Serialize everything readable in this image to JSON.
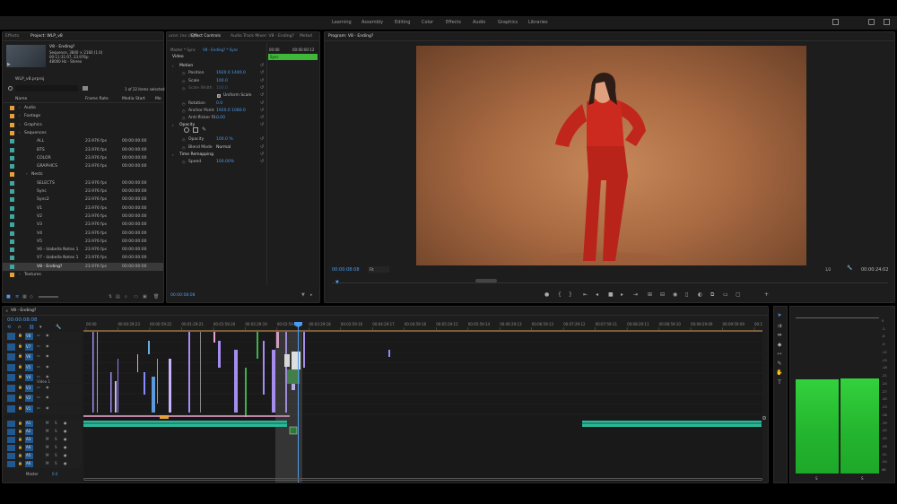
{
  "workspaces": [
    "Learning",
    "Assembly",
    "Editing",
    "Color",
    "Effects",
    "Audio",
    "Graphics",
    "Libraries"
  ],
  "project": {
    "tabs": [
      "Effects",
      "Project: WLP_v8"
    ],
    "clip_name": "V8 - Ending?",
    "clip_info": [
      "Sequence, 3840 × 2160 (1.0)",
      "00:11:31:07, 23.976p",
      "48000 Hz - Stereo"
    ],
    "file_name": "WLP_v8.prproj",
    "items_selected": "1 of 22 items selected",
    "columns": [
      "Name",
      "Frame Rate",
      "Media Start",
      "Me"
    ],
    "rows": [
      {
        "name": "Audio",
        "rate": "",
        "start": "",
        "color": "#e8a13a"
      },
      {
        "name": "Footage",
        "rate": "",
        "start": "",
        "color": "#e8a13a"
      },
      {
        "name": "Graphics",
        "rate": "",
        "start": "",
        "color": "#e8a13a"
      },
      {
        "name": "Sequences",
        "rate": "",
        "start": "",
        "color": "#e8a13a"
      },
      {
        "name": "ALL",
        "rate": "23.976 fps",
        "start": "00:00:00:00",
        "color": "#3fa6a0"
      },
      {
        "name": "BTS",
        "rate": "23.976 fps",
        "start": "00:00:00:00",
        "color": "#3fa6a0"
      },
      {
        "name": "COLOR",
        "rate": "23.976 fps",
        "start": "00:00:00:00",
        "color": "#3fa6a0"
      },
      {
        "name": "GRAPHICS",
        "rate": "23.976 fps",
        "start": "00:00:00:00",
        "color": "#3fa6a0"
      },
      {
        "name": "Nests",
        "rate": "",
        "start": "",
        "color": "#e8a13a"
      },
      {
        "name": "SELECTS",
        "rate": "23.976 fps",
        "start": "00:00:00:00",
        "color": "#3fa6a0"
      },
      {
        "name": "Sync",
        "rate": "23.976 fps",
        "start": "00:00:00:00",
        "color": "#3fa6a0"
      },
      {
        "name": "Sync2",
        "rate": "23.976 fps",
        "start": "00:00:00:00",
        "color": "#3fa6a0"
      },
      {
        "name": "V1",
        "rate": "23.976 fps",
        "start": "00:00:00:00",
        "color": "#3fa6a0"
      },
      {
        "name": "V2",
        "rate": "23.976 fps",
        "start": "00:00:00:00",
        "color": "#3fa6a0"
      },
      {
        "name": "V3",
        "rate": "23.976 fps",
        "start": "00:00:00:00",
        "color": "#3fa6a0"
      },
      {
        "name": "V4",
        "rate": "23.976 fps",
        "start": "00:00:00:00",
        "color": "#3fa6a0"
      },
      {
        "name": "V5",
        "rate": "23.976 fps",
        "start": "00:00:00:00",
        "color": "#3fa6a0"
      },
      {
        "name": "V6 - Izabella Notes 1",
        "rate": "23.976 fps",
        "start": "00:00:00:00",
        "color": "#3fa6a0"
      },
      {
        "name": "V7 - Izabella Notes 1",
        "rate": "23.976 fps",
        "start": "00:00:00:00",
        "color": "#3fa6a0"
      },
      {
        "name": "V8 - Ending?",
        "rate": "23.976 fps",
        "start": "00:00:00:00",
        "color": "#3fa6a0"
      },
      {
        "name": "Textures",
        "rate": "",
        "start": "",
        "color": "#e8a13a"
      }
    ]
  },
  "effect_controls": {
    "tabs": [
      "urce: (no clips)",
      "Effect Controls",
      "Audio Track Mixer: V8 - Ending?",
      "Metad"
    ],
    "master_label": "Master * Sync",
    "seq_label": "V8 - Ending? * Sync",
    "time_start": "00:00",
    "time_end": "00:00:00:12",
    "clip_bar": "Sync",
    "section_video": "Video",
    "params": [
      {
        "label": "Motion",
        "value": "",
        "level": 0
      },
      {
        "label": "Position",
        "value": "1920.0    1440.0",
        "level": 1
      },
      {
        "label": "Scale",
        "value": "100.0",
        "level": 1
      },
      {
        "label": "Scale Width",
        "value": "100.0",
        "level": 1
      },
      {
        "label": "Uniform Scale",
        "value": "",
        "level": 2
      },
      {
        "label": "Rotation",
        "value": "0.0",
        "level": 1
      },
      {
        "label": "Anchor Point",
        "value": "1920.0    1080.0",
        "level": 1
      },
      {
        "label": "Anti-flicker Fil...",
        "value": "0.00",
        "level": 1
      },
      {
        "label": "Opacity",
        "value": "",
        "level": 0
      },
      {
        "label": "Opacity",
        "value": "100.0 %",
        "level": 1
      },
      {
        "label": "Blend Mode",
        "value": "Normal",
        "level": 1
      },
      {
        "label": "Time Remapping",
        "value": "",
        "level": 0
      },
      {
        "label": "Speed",
        "value": "100.00%",
        "level": 1
      }
    ],
    "timecode": "00:00:08:08"
  },
  "program": {
    "tab": "Program: V8 - Ending?",
    "timecode": "00:00:08:08",
    "fit": "Fit",
    "ratio": "1/2",
    "duration": "00:00:24:02"
  },
  "timeline": {
    "tab": "V8 - Ending?",
    "timecode": "00:00:08:08",
    "ruler": [
      "00:00",
      "00:00:29:23",
      "00:00:59:22",
      "00:01:29:21",
      "00:01:59:20",
      "00:02:29:19",
      "00:02:59:18",
      "00:03:29:18",
      "00:03:59:16",
      "00:04:29:17",
      "00:04:59:16",
      "00:05:29:15",
      "00:05:59:14",
      "00:06:29:13",
      "00:06:59:13",
      "00:07:29:12",
      "00:07:59:11",
      "00:08:29:11",
      "00:08:59:10",
      "00:09:29:09",
      "00:09:59:09",
      "00:10:2"
    ],
    "video_tracks": [
      "V8",
      "V7",
      "V6",
      "V5",
      "V4",
      "V3",
      "V2",
      "V1"
    ],
    "video_label": "Video 1",
    "audio_tracks": [
      "A1",
      "A2",
      "A3",
      "A4",
      "A5",
      "A6"
    ],
    "master_label": "Master",
    "master_value": "0.0"
  },
  "meters": {
    "scale": [
      "0",
      "-3",
      "-6",
      "-9",
      "-12",
      "-15",
      "-18",
      "-21",
      "-24",
      "-27",
      "-30",
      "-33",
      "-36",
      "-39",
      "-42",
      "-45",
      "-48",
      "-51",
      "-54",
      "dB"
    ],
    "channels": [
      "S",
      "S"
    ],
    "levels": [
      0.78,
      0.79
    ]
  }
}
